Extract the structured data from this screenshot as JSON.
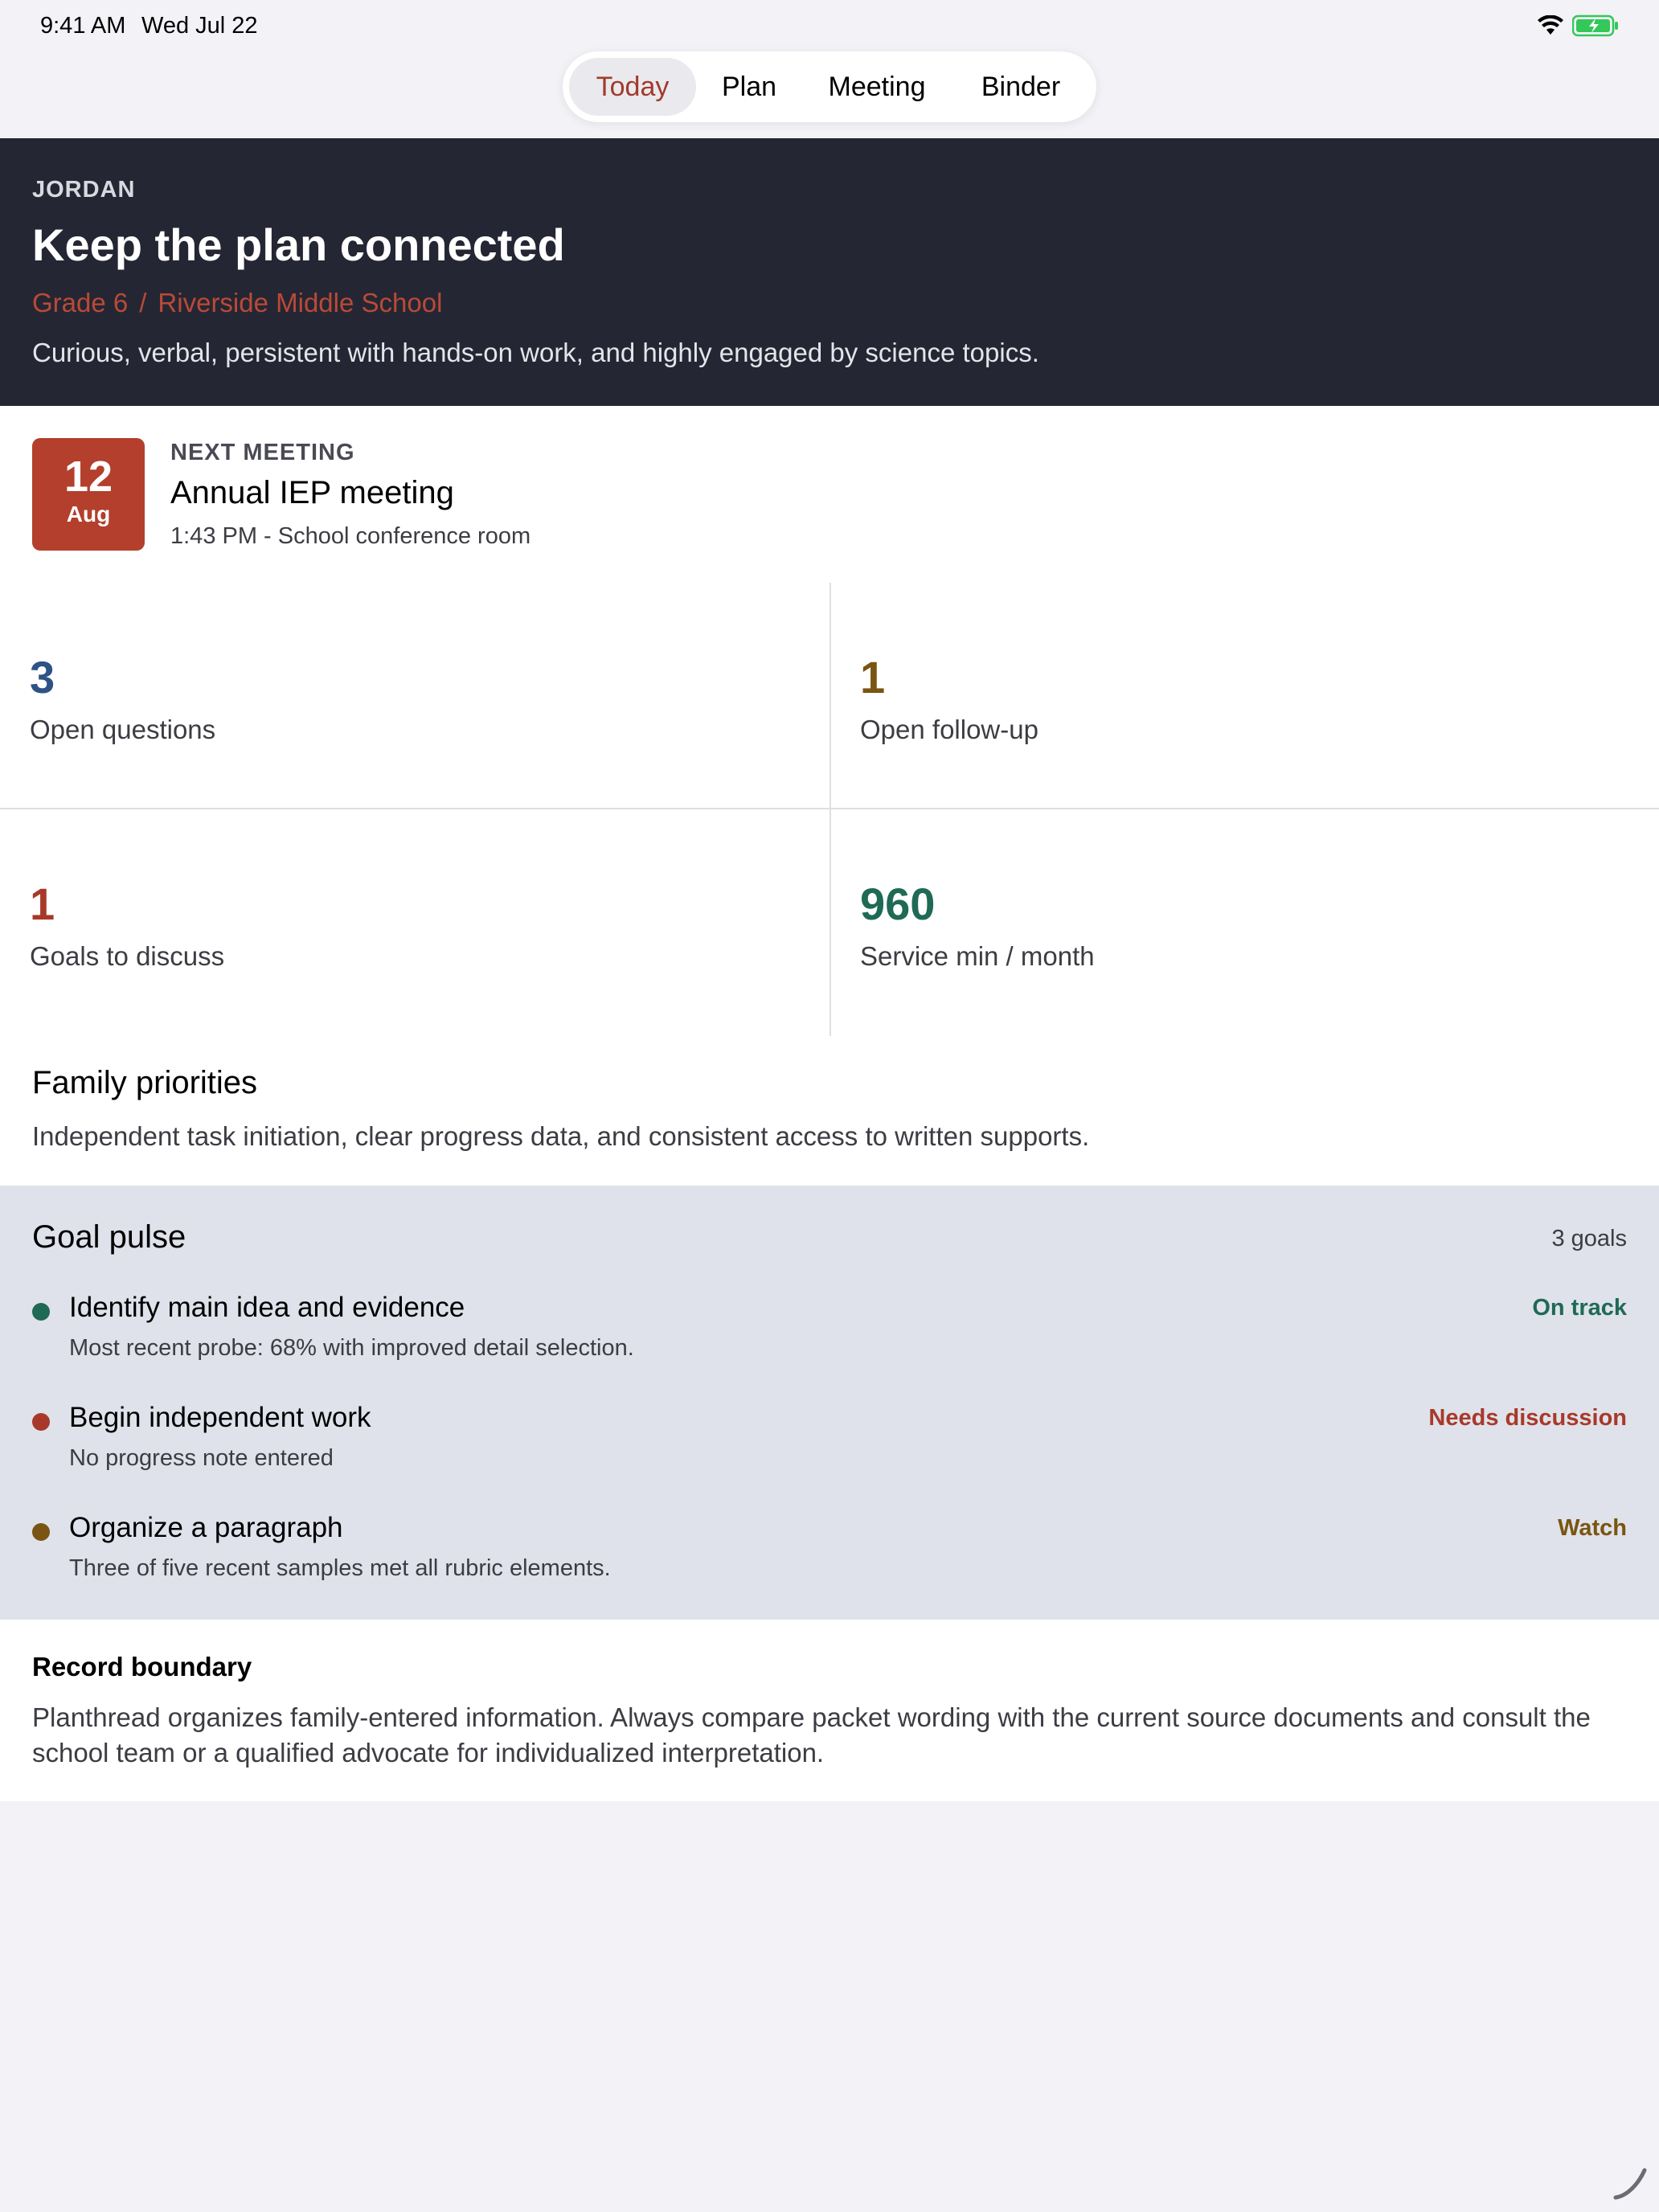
{
  "status_bar": {
    "time": "9:41 AM",
    "date": "Wed Jul 22",
    "battery_color": "#34c759"
  },
  "tabs": [
    {
      "label": "Today",
      "active": true
    },
    {
      "label": "Plan",
      "active": false
    },
    {
      "label": "Meeting",
      "active": false
    },
    {
      "label": "Binder",
      "active": false
    }
  ],
  "hero": {
    "student_name": "JORDAN",
    "title": "Keep the plan connected",
    "grade": "Grade 6",
    "separator": "/",
    "school": "Riverside Middle School",
    "description": "Curious, verbal, persistent with hands-on work, and highly engaged by science topics."
  },
  "next_meeting": {
    "day": "12",
    "month": "Aug",
    "label": "NEXT MEETING",
    "title": "Annual IEP meeting",
    "detail": "1:43 PM - School conference room"
  },
  "stats": [
    {
      "value": "3",
      "label": "Open questions",
      "color": "#2f5286"
    },
    {
      "value": "1",
      "label": "Open follow-up",
      "color": "#7a5412"
    },
    {
      "value": "1",
      "label": "Goals to discuss",
      "color": "#a8392a"
    },
    {
      "value": "960",
      "label": "Service min / month",
      "color": "#1f6a55"
    }
  ],
  "family_priorities": {
    "title": "Family priorities",
    "text": "Independent task initiation, clear progress data, and consistent access to written supports."
  },
  "goal_pulse": {
    "title": "Goal pulse",
    "count": "3 goals",
    "goals": [
      {
        "name": "Identify main idea and evidence",
        "note": "Most recent probe: 68% with improved detail selection.",
        "status": "On track",
        "color": "#1f6a55"
      },
      {
        "name": "Begin independent work",
        "note": "No progress note entered",
        "status": "Needs discussion",
        "color": "#a8392a"
      },
      {
        "name": "Organize a paragraph",
        "note": "Three of five recent samples met all rubric elements.",
        "status": "Watch",
        "color": "#7a5412"
      }
    ]
  },
  "record_boundary": {
    "title": "Record boundary",
    "text": "Planthread organizes family-entered information. Always compare packet wording with the current source documents and consult the school team or a qualified advocate for individualized interpretation."
  }
}
